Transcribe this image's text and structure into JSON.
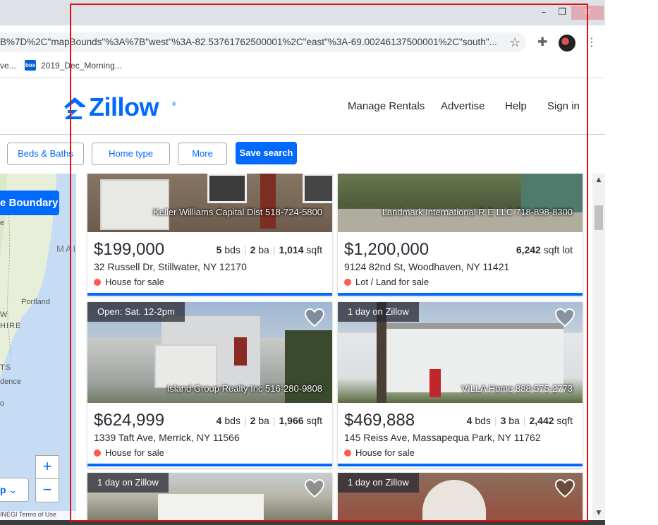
{
  "browser": {
    "url_text": "B%7D%2C\"mapBounds\"%3A%7B\"west\"%3A-82.53761762500001%2C\"east\"%3A-69.00246137500001%2C\"south\"...",
    "bookmarks": [
      {
        "label": "ve..."
      },
      {
        "label": "2019_Dec_Morning...",
        "icon": "box-icon",
        "icon_text": "box"
      }
    ],
    "window_controls": {
      "minimize": "–",
      "restore": "❐",
      "close": "✕"
    }
  },
  "header": {
    "logo": "Zillow",
    "nav": [
      "Manage Rentals",
      "Advertise",
      "Help",
      "Sign in"
    ]
  },
  "filters": {
    "beds_baths": "Beds & Baths",
    "home_type": "Home type",
    "more": "More",
    "save_search": "Save search"
  },
  "map": {
    "boundary_button": "e Boundary",
    "labels": [
      "e",
      "MAI",
      "Portland",
      "W",
      "HIRE",
      "TS",
      "dence",
      "o"
    ],
    "zoom_in": "+",
    "zoom_out": "−",
    "select_label": "p",
    "attribution": "INEGI  Terms of Use"
  },
  "listings": [
    {
      "price": "$199,000",
      "beds": "5",
      "baths": "2",
      "sqft": "1,014",
      "bds_label": "bds",
      "ba_label": "ba",
      "sqft_label": "sqft",
      "address": "32 Russell Dr, Stillwater, NY 12170",
      "status": "House for sale",
      "broker": "Keller Williams Capital Dist 518-724-5800"
    },
    {
      "price": "$1,200,000",
      "lot": "6,242",
      "lot_label": "sqft lot",
      "address": "9124 82nd St, Woodhaven, NY 11421",
      "status": "Lot / Land for sale",
      "broker": "Landmark International R E LLC 718-898-8300"
    },
    {
      "price": "$624,999",
      "beds": "4",
      "baths": "2",
      "sqft": "1,966",
      "bds_label": "bds",
      "ba_label": "ba",
      "sqft_label": "sqft",
      "address": "1339 Taft Ave, Merrick, NY 11566",
      "status": "House for sale",
      "broker": "Island Group Realty Inc 516-280-9808",
      "badge": "Open: Sat. 12-2pm"
    },
    {
      "price": "$469,888",
      "beds": "4",
      "baths": "3",
      "sqft": "2,442",
      "bds_label": "bds",
      "ba_label": "ba",
      "sqft_label": "sqft",
      "address": "145 Reiss Ave, Massapequa Park, NY 11762",
      "status": "House for sale",
      "broker": "VILLA Home 888-575-2773",
      "badge": "1 day on Zillow"
    },
    {
      "badge": "1 day on Zillow"
    },
    {
      "badge": "1 day on Zillow"
    }
  ],
  "colors": {
    "zillow_blue": "#006aff",
    "status_red": "#ff5a4f",
    "text": "#2a2a33"
  }
}
